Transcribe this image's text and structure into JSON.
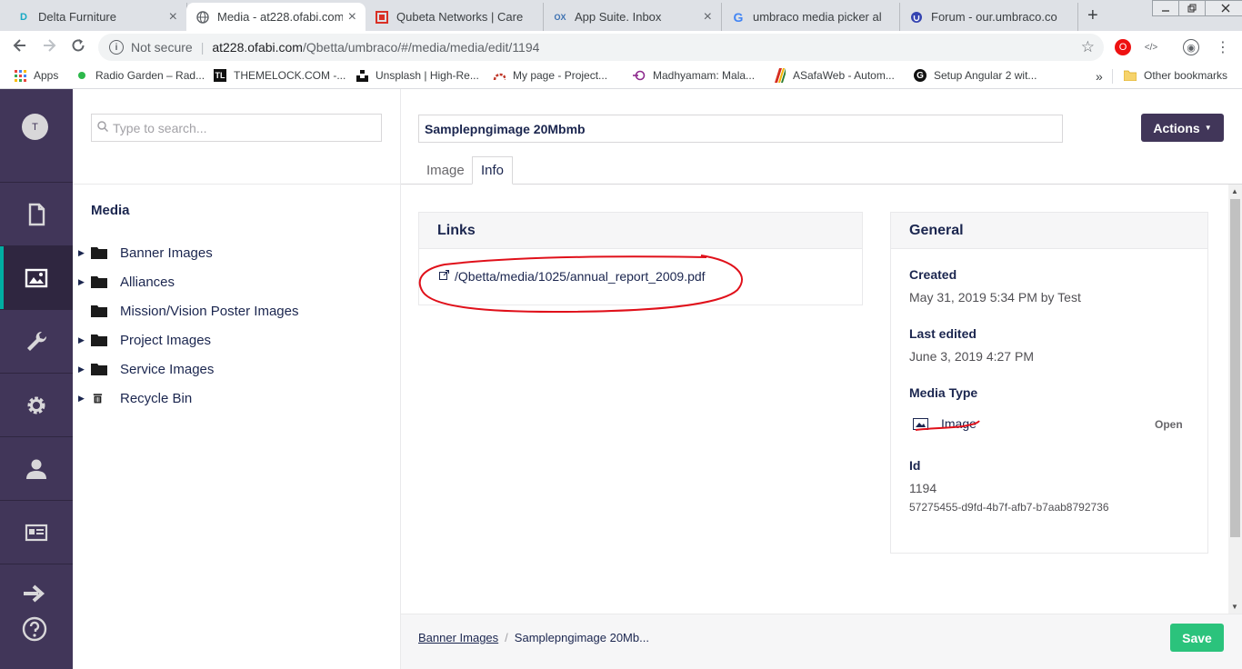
{
  "browser": {
    "tabs": [
      {
        "title": "Delta Furniture",
        "icon": "delta-icon"
      },
      {
        "title": "Media - at228.ofabi.com",
        "icon": "globe-icon"
      },
      {
        "title": "Qubeta Networks | Care",
        "icon": "qubeta-icon"
      },
      {
        "title": "App Suite. Inbox",
        "icon": "ox-icon"
      },
      {
        "title": "umbraco media picker al",
        "icon": "google-icon"
      },
      {
        "title": "Forum - our.umbraco.co",
        "icon": "umbraco-icon"
      }
    ],
    "tab_close": "×",
    "new_tab": "+",
    "security_label": "Not secure",
    "url_host": "at228.ofabi.com",
    "url_path": "/Qbetta/umbraco/#/media/media/edit/1194",
    "bookmarks": [
      {
        "label": "Apps"
      },
      {
        "label": "Radio Garden – Rad..."
      },
      {
        "label": "THEMELOCK.COM -..."
      },
      {
        "label": "Unsplash | High-Re..."
      },
      {
        "label": "My page - Project..."
      },
      {
        "label": "Madhyamam: Mala..."
      },
      {
        "label": "ASafaWeb - Autom..."
      },
      {
        "label": "Setup Angular 2 wit..."
      }
    ],
    "more_bookmarks": "»",
    "other_bookmarks": "Other bookmarks",
    "tl_badge": "TL",
    "ox_badge": "OX"
  },
  "umbraco": {
    "user_initial": "T",
    "search_placeholder": "Type to search...",
    "tree_title": "Media",
    "tree_items": [
      {
        "label": "Banner Images",
        "has_children": true,
        "icon": "folder-icon"
      },
      {
        "label": "Alliances",
        "has_children": true,
        "icon": "folder-icon"
      },
      {
        "label": "Mission/Vision Poster Images",
        "has_children": false,
        "icon": "folder-icon"
      },
      {
        "label": "Project Images",
        "has_children": true,
        "icon": "folder-icon"
      },
      {
        "label": "Service Images",
        "has_children": true,
        "icon": "folder-icon"
      },
      {
        "label": "Recycle Bin",
        "has_children": true,
        "icon": "trash-icon"
      }
    ],
    "editor": {
      "name_value": "Samplepngimage 20Mbmb",
      "actions_label": "Actions",
      "tabs": [
        {
          "label": "Image",
          "active": false
        },
        {
          "label": "Info",
          "active": true
        }
      ],
      "links_title": "Links",
      "link_url": "/Qbetta/media/1025/annual_report_2009.pdf",
      "general_title": "General",
      "created_label": "Created",
      "created_value": "May 31, 2019 5:34 PM by Test",
      "last_edited_label": "Last edited",
      "last_edited_value": "June 3, 2019 4:27 PM",
      "media_type_label": "Media Type",
      "media_type_value": "Image",
      "open_label": "Open",
      "id_label": "Id",
      "id_value": "1194",
      "guid_value": "57275455-d9fd-4b7f-afb7-b7aab8792736"
    },
    "footer": {
      "breadcrumb_root": "Banner Images",
      "breadcrumb_sep": "/",
      "breadcrumb_current": "Samplepngimage 20Mb...",
      "save_label": "Save"
    }
  },
  "colors": {
    "sidebar": "#413659",
    "sidebar_active_accent": "#00aea2",
    "save_button": "#2bc37c",
    "annotation": "#e0101a"
  }
}
